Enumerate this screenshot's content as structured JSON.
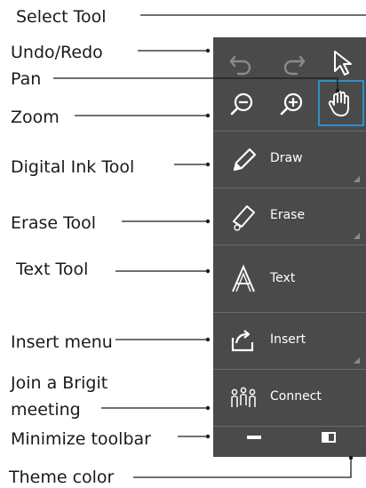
{
  "labels": {
    "select_tool": "Select Tool",
    "undo_redo": "Undo/Redo",
    "pan": "Pan",
    "zoom": "Zoom",
    "digital_ink": "Digital Ink Tool",
    "erase_tool": "Erase Tool",
    "text_tool": "Text Tool",
    "insert_menu": "Insert menu",
    "join_line1": "Join a Brigit",
    "join_line2": "meeting",
    "minimize": "Minimize toolbar",
    "theme": "Theme color"
  },
  "toolbar": {
    "draw": "Draw",
    "erase": "Erase",
    "text": "Text",
    "insert": "Insert",
    "connect": "Connect"
  },
  "colors": {
    "toolbar_bg": "#4a4a4a",
    "selected_outline": "#2e8fc9"
  },
  "icons": [
    "undo-icon",
    "redo-icon",
    "select-arrow-icon",
    "zoom-out-icon",
    "zoom-in-icon",
    "pan-hand-icon",
    "pen-icon",
    "eraser-icon",
    "text-a-icon",
    "insert-icon",
    "people-icon",
    "minimize-icon",
    "theme-icon"
  ]
}
